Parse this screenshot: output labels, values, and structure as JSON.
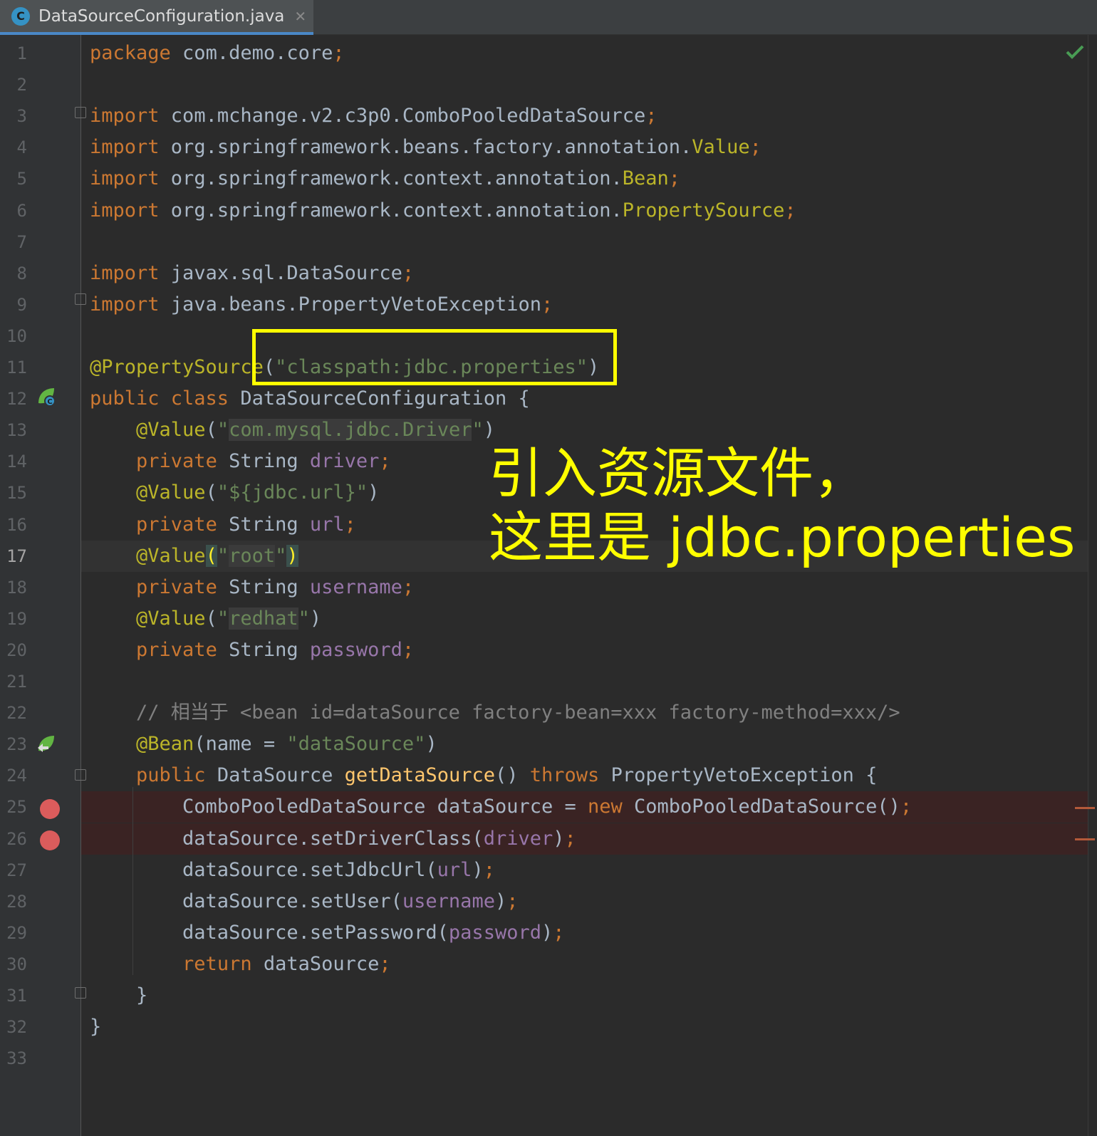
{
  "tab": {
    "icon_letter": "C",
    "filename": "DataSourceConfiguration.java",
    "close_glyph": "✕"
  },
  "status": {
    "inspection": "no-problems-check-icon",
    "check_glyph": "✔"
  },
  "lines": [
    {
      "n": "1",
      "segs": [
        [
          "package",
          "kw"
        ],
        [
          " com.demo.core",
          ""
        ],
        [
          ";",
          "kw"
        ]
      ]
    },
    {
      "n": "2",
      "segs": []
    },
    {
      "n": "3",
      "segs": [
        [
          "import",
          "kw"
        ],
        [
          " com.mchange.v2.c3p0.ComboPooledDataSource",
          ""
        ],
        [
          ";",
          "kw"
        ]
      ]
    },
    {
      "n": "4",
      "segs": [
        [
          "import",
          "kw"
        ],
        [
          " org.springframework.beans.factory.annotation.",
          ""
        ],
        [
          "Value",
          "ann"
        ],
        [
          ";",
          "kw"
        ]
      ]
    },
    {
      "n": "5",
      "segs": [
        [
          "import",
          "kw"
        ],
        [
          " org.springframework.context.annotation.",
          ""
        ],
        [
          "Bean",
          "ann"
        ],
        [
          ";",
          "kw"
        ]
      ]
    },
    {
      "n": "6",
      "segs": [
        [
          "import",
          "kw"
        ],
        [
          " org.springframework.context.annotation.",
          ""
        ],
        [
          "PropertySource",
          "ann"
        ],
        [
          ";",
          "kw"
        ]
      ]
    },
    {
      "n": "7",
      "segs": []
    },
    {
      "n": "8",
      "segs": [
        [
          "import",
          "kw"
        ],
        [
          " javax.sql.DataSource",
          ""
        ],
        [
          ";",
          "kw"
        ]
      ]
    },
    {
      "n": "9",
      "segs": [
        [
          "import",
          "kw"
        ],
        [
          " java.beans.PropertyVetoException",
          ""
        ],
        [
          ";",
          "kw"
        ]
      ]
    },
    {
      "n": "10",
      "segs": []
    },
    {
      "n": "11",
      "segs": [
        [
          "@PropertySource",
          "ann"
        ],
        [
          "(",
          ""
        ],
        [
          "\"classpath:jdbc.properties\"",
          "str"
        ],
        [
          ")",
          ""
        ]
      ]
    },
    {
      "n": "12",
      "segs": [
        [
          "public class",
          "kw"
        ],
        [
          " DataSourceConfiguration {",
          ""
        ]
      ]
    },
    {
      "n": "13",
      "segs": [
        [
          "    ",
          ""
        ],
        [
          "@Value",
          "ann"
        ],
        [
          "(",
          ""
        ],
        [
          "\"",
          "str"
        ],
        [
          "com.mysql.jdbc.Driver",
          "str hl"
        ],
        [
          "\"",
          "str"
        ],
        [
          ")",
          ""
        ]
      ]
    },
    {
      "n": "14",
      "segs": [
        [
          "    ",
          ""
        ],
        [
          "private",
          "kw"
        ],
        [
          " String ",
          ""
        ],
        [
          "driver",
          "fld"
        ],
        [
          ";",
          "kw"
        ]
      ]
    },
    {
      "n": "15",
      "segs": [
        [
          "    ",
          ""
        ],
        [
          "@Value",
          "ann"
        ],
        [
          "(",
          ""
        ],
        [
          "\"${jdbc.url}\"",
          "str"
        ],
        [
          ")",
          ""
        ]
      ]
    },
    {
      "n": "16",
      "segs": [
        [
          "    ",
          ""
        ],
        [
          "private",
          "kw"
        ],
        [
          " String ",
          ""
        ],
        [
          "url",
          "fld"
        ],
        [
          ";",
          "kw"
        ]
      ]
    },
    {
      "n": "17",
      "segs": [
        [
          "    ",
          ""
        ],
        [
          "@Value",
          "ann"
        ],
        [
          "(",
          "brace"
        ],
        [
          "\"",
          "str"
        ],
        [
          "root",
          "str hl"
        ],
        [
          "\"",
          "str"
        ],
        [
          ")",
          "brace"
        ]
      ]
    },
    {
      "n": "18",
      "segs": [
        [
          "    ",
          ""
        ],
        [
          "private",
          "kw"
        ],
        [
          " String ",
          ""
        ],
        [
          "username",
          "fld"
        ],
        [
          ";",
          "kw"
        ]
      ]
    },
    {
      "n": "19",
      "segs": [
        [
          "    ",
          ""
        ],
        [
          "@Value",
          "ann"
        ],
        [
          "(",
          ""
        ],
        [
          "\"",
          "str"
        ],
        [
          "redhat",
          "str hl"
        ],
        [
          "\"",
          "str"
        ],
        [
          ")",
          ""
        ]
      ]
    },
    {
      "n": "20",
      "segs": [
        [
          "    ",
          ""
        ],
        [
          "private",
          "kw"
        ],
        [
          " String ",
          ""
        ],
        [
          "password",
          "fld"
        ],
        [
          ";",
          "kw"
        ]
      ]
    },
    {
      "n": "21",
      "segs": []
    },
    {
      "n": "22",
      "segs": [
        [
          "    ",
          ""
        ],
        [
          "// 相当于 <bean id=dataSource factory-bean=xxx factory-method=xxx/>",
          "cmt"
        ]
      ]
    },
    {
      "n": "23",
      "segs": [
        [
          "    ",
          ""
        ],
        [
          "@Bean",
          "ann"
        ],
        [
          "(name = ",
          ""
        ],
        [
          "\"dataSource\"",
          "str"
        ],
        [
          ")",
          ""
        ]
      ]
    },
    {
      "n": "24",
      "segs": [
        [
          "    ",
          ""
        ],
        [
          "public",
          "kw"
        ],
        [
          " DataSource ",
          ""
        ],
        [
          "getDataSource",
          "mth"
        ],
        [
          "() ",
          ""
        ],
        [
          "throws",
          "kw"
        ],
        [
          " PropertyVetoException {",
          ""
        ]
      ]
    },
    {
      "n": "25",
      "segs": [
        [
          "        ComboPooledDataSource dataSource = ",
          ""
        ],
        [
          "new",
          "kw"
        ],
        [
          " ComboPooledDataSource()",
          ""
        ],
        [
          ";",
          "kw"
        ]
      ]
    },
    {
      "n": "26",
      "segs": [
        [
          "        dataSource.setDriverClass(",
          ""
        ],
        [
          "driver",
          "fld"
        ],
        [
          ")",
          ""
        ],
        [
          ";",
          "kw"
        ]
      ]
    },
    {
      "n": "27",
      "segs": [
        [
          "        dataSource.setJdbcUrl(",
          ""
        ],
        [
          "url",
          "fld"
        ],
        [
          ")",
          ""
        ],
        [
          ";",
          "kw"
        ]
      ]
    },
    {
      "n": "28",
      "segs": [
        [
          "        dataSource.setUser(",
          ""
        ],
        [
          "username",
          "fld"
        ],
        [
          ")",
          ""
        ],
        [
          ";",
          "kw"
        ]
      ]
    },
    {
      "n": "29",
      "segs": [
        [
          "        dataSource.setPassword(",
          ""
        ],
        [
          "password",
          "fld"
        ],
        [
          ")",
          ""
        ],
        [
          ";",
          "kw"
        ]
      ]
    },
    {
      "n": "30",
      "segs": [
        [
          "        ",
          ""
        ],
        [
          "return",
          "kw"
        ],
        [
          " dataSource",
          ""
        ],
        [
          ";",
          "kw"
        ]
      ]
    },
    {
      "n": "31",
      "segs": [
        [
          "    }",
          ""
        ]
      ]
    },
    {
      "n": "32",
      "segs": [
        [
          "}",
          ""
        ]
      ]
    },
    {
      "n": "33",
      "segs": []
    }
  ],
  "current_line": "17",
  "breakpoint_lines": [
    "25",
    "26"
  ],
  "annotation": {
    "line1": "引入资源文件，",
    "line2": "这里是 jdbc.properties",
    "color": "#ffff00"
  }
}
